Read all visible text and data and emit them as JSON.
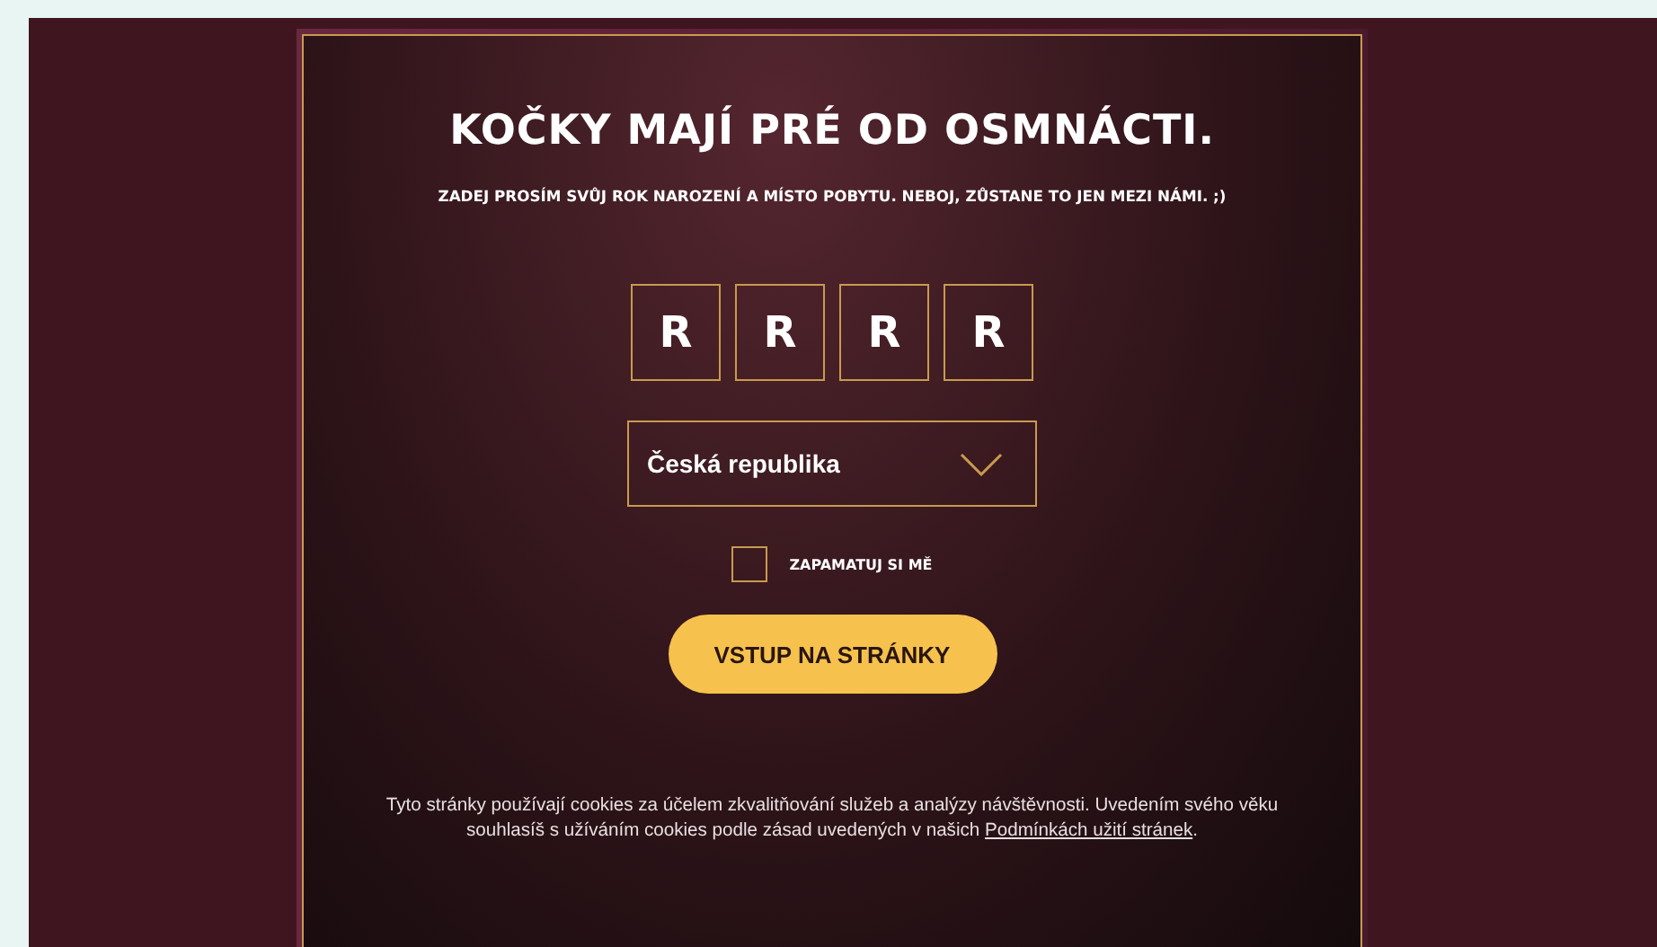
{
  "title": "KOČKY MAJÍ PRÉ OD OSMNÁCTI.",
  "subtitle": "ZADEJ PROSÍM SVŮJ ROK NAROZENÍ A MÍSTO POBYTU. NEBOJ, ZŮSTANE TO JEN MEZI NÁMI. ;)",
  "year_fields": [
    "R",
    "R",
    "R",
    "R"
  ],
  "country_select": {
    "value": "Česká republika"
  },
  "remember": {
    "label": "ZAPAMATUJ SI MĚ",
    "checked": false
  },
  "enter_button": "VSTUP NA STRÁNKY",
  "cookie_notice": {
    "text": "Tyto stránky používají cookies za účelem zkvalitňování služeb a analýzy návštěvnosti. Uvedením svého věku souhlasíš s užíváním cookies podle zásad uvedených v našich",
    "link": "Podmínkách užití stránek",
    "end": "."
  }
}
